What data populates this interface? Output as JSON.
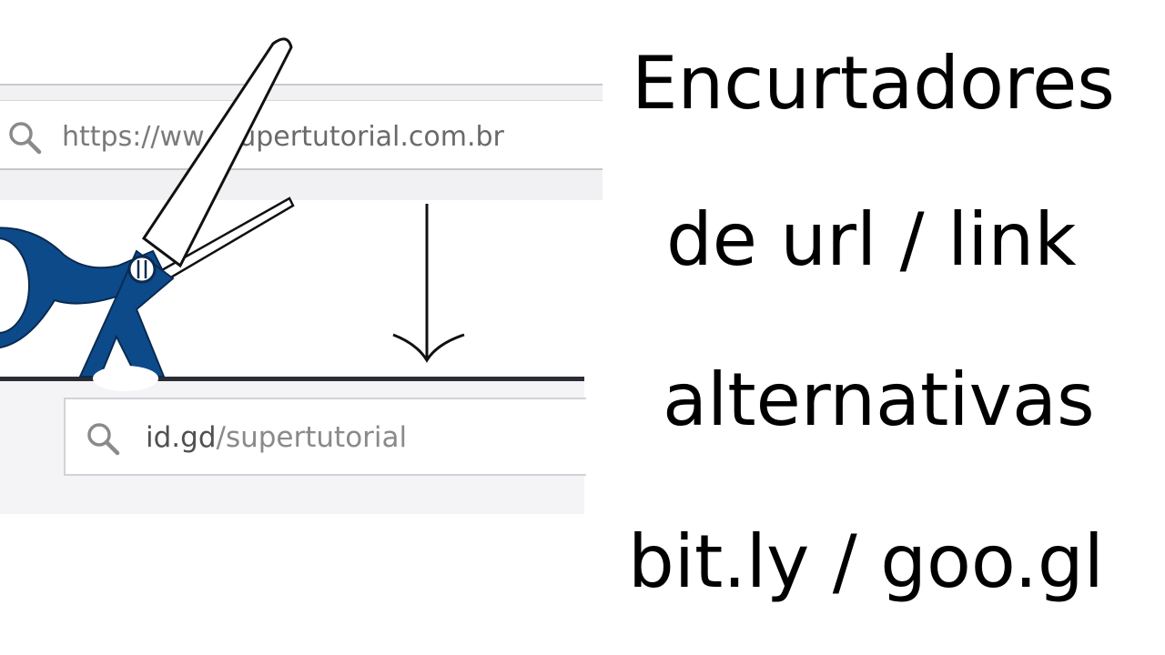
{
  "illustration": {
    "long_url": {
      "prefix": "https://ww",
      "domain": "supertutorial.com.br",
      "icon": "search-icon"
    },
    "short_url": {
      "domain": "id.gd",
      "path": "/supertutorial",
      "icon": "search-icon"
    },
    "scissors_color": "#0d4a8a",
    "arrow_icon": "down-arrow-icon"
  },
  "title": {
    "line1": "Encurtadores",
    "line2": "de url / link",
    "line3": "alternativas",
    "line4": "bit.ly / goo.gl"
  }
}
